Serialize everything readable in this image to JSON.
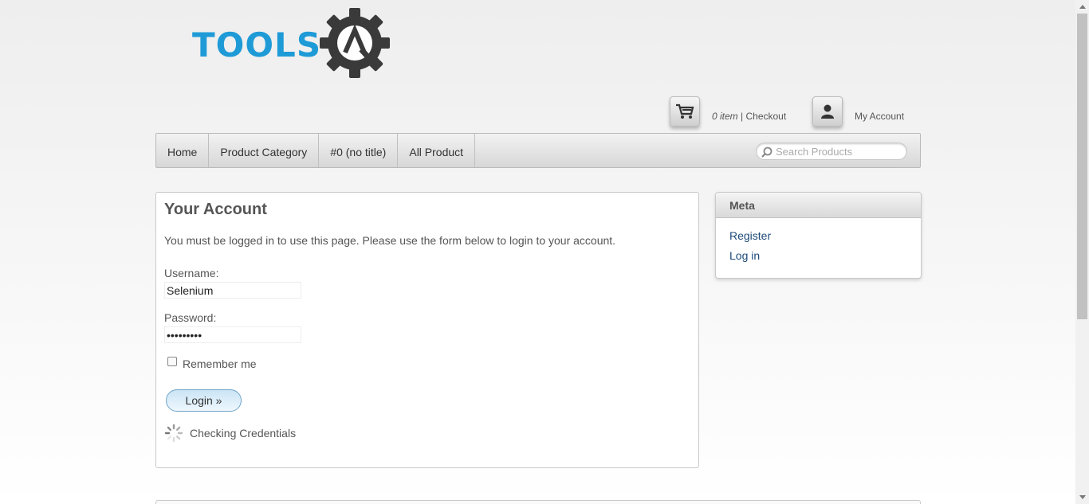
{
  "logo": {
    "text": "TOOLS",
    "badge_letter": "A"
  },
  "header": {
    "cart_count": "0 item",
    "cart_separator": " | ",
    "checkout_label": "Checkout",
    "my_account_label": "My Account"
  },
  "nav": {
    "items": [
      {
        "label": "Home"
      },
      {
        "label": "Product Category"
      },
      {
        "label": "#0 (no title)"
      },
      {
        "label": "All Product"
      }
    ],
    "search_placeholder": "Search Products"
  },
  "account": {
    "title": "Your Account",
    "intro": "You must be logged in to use this page. Please use the form below to login to your account.",
    "username_label": "Username:",
    "username_value": "Selenium",
    "password_label": "Password:",
    "password_value": "•••••••••",
    "remember_label": "Remember me",
    "remember_checked": false,
    "login_button": "Login »",
    "status_text": "Checking Credentials"
  },
  "meta": {
    "title": "Meta",
    "links": [
      {
        "label": "Register"
      },
      {
        "label": "Log in"
      }
    ]
  },
  "colors": {
    "brand": "#1e9bd7",
    "link": "#1e4a7a",
    "gear": "#3a3a3a"
  }
}
